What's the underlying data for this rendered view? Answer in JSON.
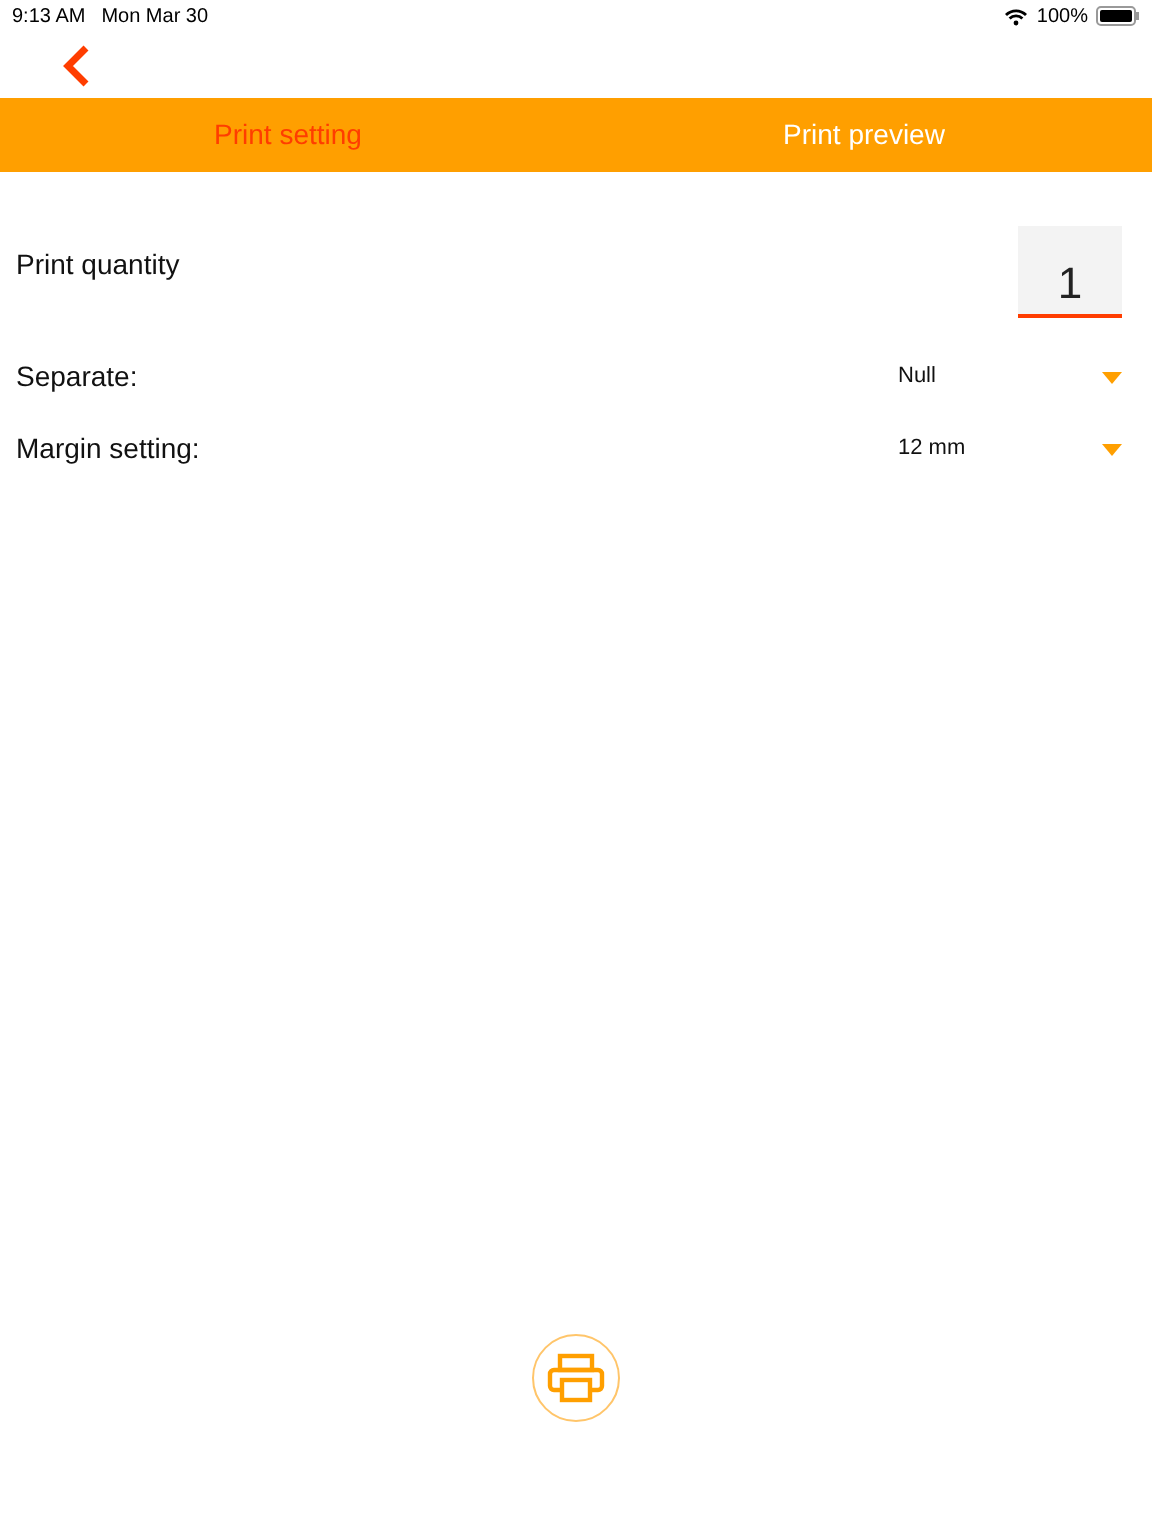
{
  "status_bar": {
    "time": "9:13 AM",
    "date": "Mon Mar 30",
    "battery": "100%"
  },
  "tabs": [
    {
      "label": "Print setting",
      "selected": true
    },
    {
      "label": "Print preview",
      "selected": false
    }
  ],
  "quantity": {
    "label": "Print quantity",
    "value": "1"
  },
  "settings": [
    {
      "label": "Separate:",
      "value": "Null"
    },
    {
      "label": "Margin setting:",
      "value": "12 mm"
    }
  ]
}
